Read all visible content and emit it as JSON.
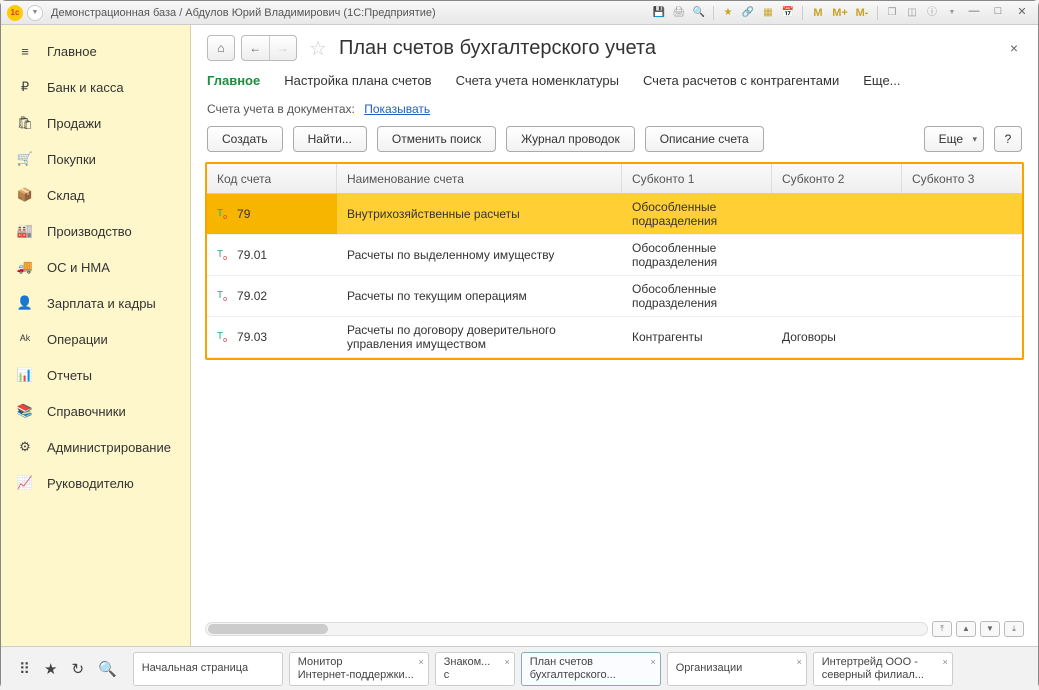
{
  "titlebar": {
    "logo_text": "1c",
    "text": "Демонстрационная база / Абдулов Юрий Владимирович  (1С:Предприятие)",
    "m1": "M",
    "m2": "M+",
    "m3": "M-"
  },
  "sidebar": {
    "items": [
      {
        "icon": "≡",
        "label": "Главное"
      },
      {
        "icon": "₽",
        "label": "Банк и касса"
      },
      {
        "icon": "🛍",
        "label": "Продажи"
      },
      {
        "icon": "🛒",
        "label": "Покупки"
      },
      {
        "icon": "📦",
        "label": "Склад"
      },
      {
        "icon": "🏭",
        "label": "Производство"
      },
      {
        "icon": "🚚",
        "label": "ОС и НМА"
      },
      {
        "icon": "👤",
        "label": "Зарплата и кадры"
      },
      {
        "icon": "ᴬᵏ",
        "label": "Операции"
      },
      {
        "icon": "📊",
        "label": "Отчеты"
      },
      {
        "icon": "📚",
        "label": "Справочники"
      },
      {
        "icon": "⚙",
        "label": "Администрирование"
      },
      {
        "icon": "📈",
        "label": "Руководителю"
      }
    ]
  },
  "page": {
    "title": "План счетов бухгалтерского учета",
    "subtabs": [
      "Главное",
      "Настройка плана счетов",
      "Счета учета номенклатуры",
      "Счета расчетов с контрагентами",
      "Еще..."
    ],
    "infoline_label": "Счета учета в документах:",
    "infoline_link": "Показывать"
  },
  "toolbar": {
    "create": "Создать",
    "find": "Найти...",
    "cancel_find": "Отменить поиск",
    "journal": "Журнал проводок",
    "desc": "Описание счета",
    "more": "Еще",
    "help": "?"
  },
  "table": {
    "headers": {
      "c1": "Код счета",
      "c2": "Наименование счета",
      "c3": "Субконто 1",
      "c4": "Субконто 2",
      "c5": "Субконто 3"
    },
    "rows": [
      {
        "code": "79",
        "name": "Внутрихозяйственные расчеты",
        "s1": "Обособленные подразделения",
        "s2": "",
        "s3": "",
        "sel": true
      },
      {
        "code": "79.01",
        "name": "Расчеты по выделенному имуществу",
        "s1": "Обособленные подразделения",
        "s2": "",
        "s3": ""
      },
      {
        "code": "79.02",
        "name": "Расчеты по текущим операциям",
        "s1": "Обособленные подразделения",
        "s2": "",
        "s3": ""
      },
      {
        "code": "79.03",
        "name": "Расчеты по договору доверительного управления имуществом",
        "s1": "Контрагенты",
        "s2": "Договоры",
        "s3": ""
      }
    ]
  },
  "bottomtabs": [
    {
      "l1": "Начальная страница",
      "l2": ""
    },
    {
      "l1": "Монитор",
      "l2": "Интернет-поддержки..."
    },
    {
      "l1": "Знаком...",
      "l2": "с"
    },
    {
      "l1": "План счетов",
      "l2": "бухгалтерского...",
      "active": true
    },
    {
      "l1": "Организации",
      "l2": ""
    },
    {
      "l1": "Интертрейд ООО -",
      "l2": "северный филиал..."
    }
  ]
}
